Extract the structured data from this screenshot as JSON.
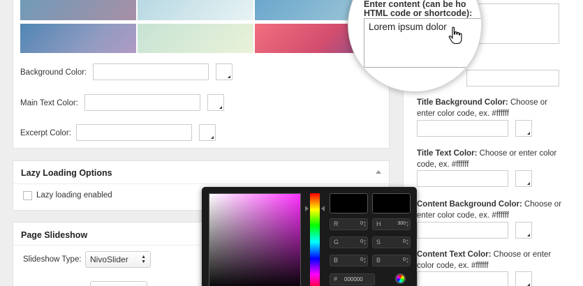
{
  "settings": {
    "background_color_label": "Background Color:",
    "main_text_color_label": "Main Text Color:",
    "excerpt_color_label": "Excerpt Color:"
  },
  "lazy_loading": {
    "title": "Lazy Loading Options",
    "checkbox_label": "Lazy loading enabled"
  },
  "slideshow": {
    "title": "Page Slideshow",
    "type_label": "Slideshow Type:",
    "type_value": "NivoSlider"
  },
  "magnifier": {
    "line1": "Enter content (can be ho",
    "line2": "HTML code or shortcode):",
    "textarea_value": "Lorem ipsum dolor"
  },
  "right_column": {
    "title_bg": {
      "bold": "Title Background Color:",
      "rest": " Choose or enter color code, ex. #ffffff"
    },
    "title_text": {
      "bold": "Title Text Color:",
      "rest": " Choose or enter color code, ex. #ffffff"
    },
    "content_bg": {
      "bold": "Content Background Color:",
      "rest": " Choose or enter color code, ex. #ffffff"
    },
    "content_text": {
      "bold": "Content Text Color:",
      "rest": " Choose or enter color code, ex. #ffffff"
    }
  },
  "color_picker": {
    "r": "R",
    "r_value": "0",
    "g": "G",
    "g_value": "0",
    "b": "B",
    "b_value": "0",
    "h": "H",
    "h_value": "300",
    "s": "S",
    "s_value": "0",
    "b2": "B",
    "b2_value": "0",
    "hex_symbol": "#",
    "hex_value": "000000"
  },
  "colors": {
    "picker_bg": "#1b1b1b",
    "panel_bg": "#ffffff",
    "page_bg": "#eeeeee"
  }
}
